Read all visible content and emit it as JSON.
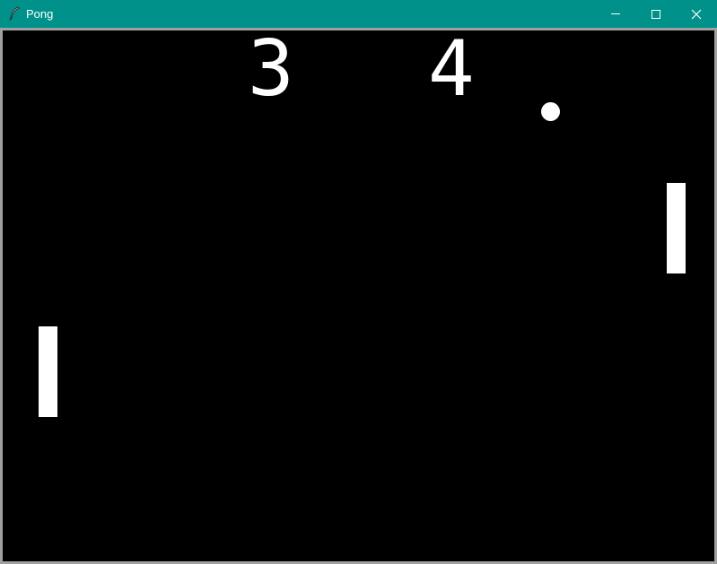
{
  "window": {
    "title": "Pong",
    "titlebar_color": "#00918a",
    "icons": {
      "app": "feather-icon",
      "minimize": "minimize-icon",
      "maximize": "maximize-icon",
      "close": "close-icon"
    }
  },
  "game": {
    "background_color": "#000000",
    "foreground_color": "#ffffff",
    "score_left": "3",
    "score_right": "4"
  }
}
